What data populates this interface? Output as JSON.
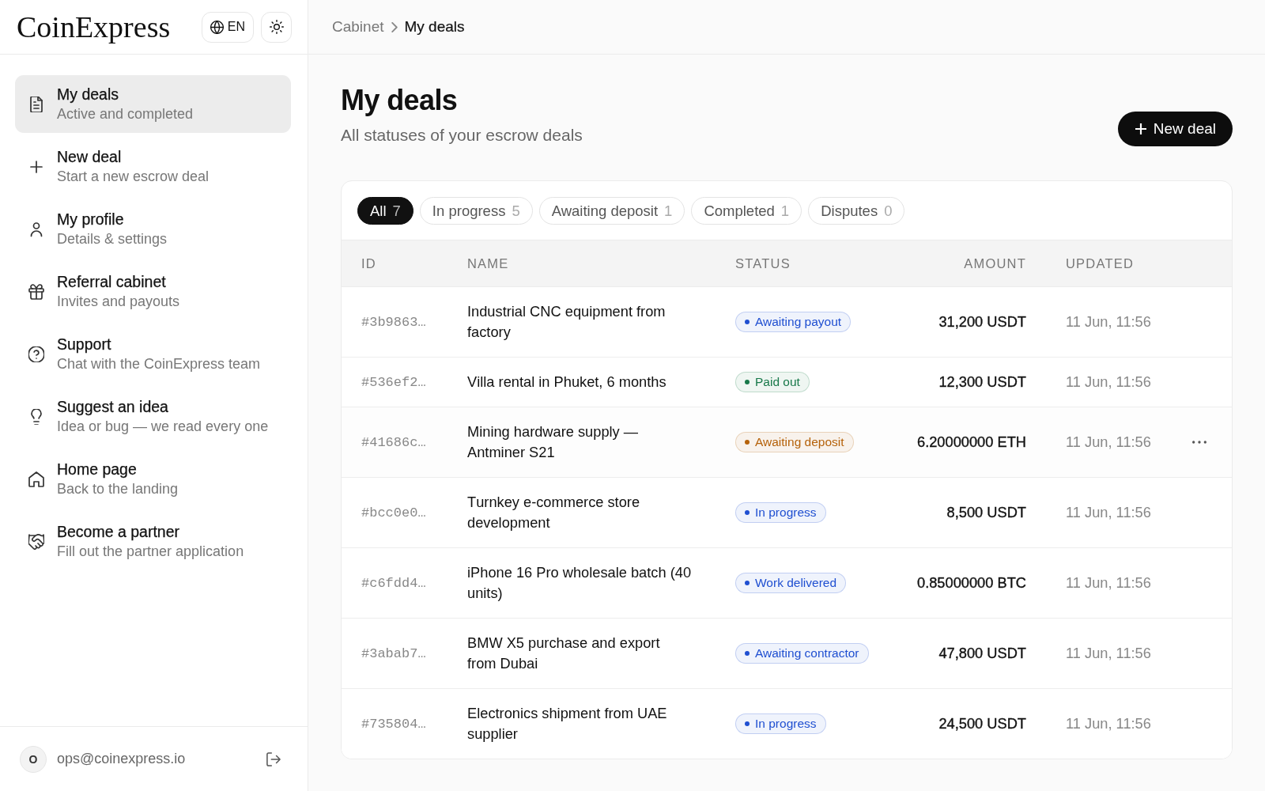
{
  "sidebar": {
    "logo": "CoinExpress",
    "language": "EN",
    "nav": [
      {
        "title": "My deals",
        "subtitle": "Active and completed",
        "selected": true
      },
      {
        "title": "New deal",
        "subtitle": "Start a new escrow deal",
        "selected": false
      },
      {
        "title": "My profile",
        "subtitle": "Details & settings",
        "selected": false
      },
      {
        "title": "Referral cabinet",
        "subtitle": "Invites and payouts",
        "selected": false
      },
      {
        "title": "Support",
        "subtitle": "Chat with the CoinExpress team",
        "selected": false
      },
      {
        "title": "Suggest an idea",
        "subtitle": "Idea or bug — we read every one",
        "selected": false
      },
      {
        "title": "Home page",
        "subtitle": "Back to the landing",
        "selected": false
      },
      {
        "title": "Become a partner",
        "subtitle": "Fill out the partner application",
        "selected": false
      }
    ],
    "user": {
      "initial": "O",
      "email": "ops@coinexpress.io"
    }
  },
  "breadcrumb": [
    {
      "label": "Cabinet",
      "current": false
    },
    {
      "label": "My deals",
      "current": true
    }
  ],
  "page": {
    "title": "My deals",
    "subtitle": "All statuses of your escrow deals",
    "new_deal_button": "New deal"
  },
  "filters": [
    {
      "label": "All",
      "count": "7",
      "selected": true
    },
    {
      "label": "In progress",
      "count": "5",
      "selected": false
    },
    {
      "label": "Awaiting deposit",
      "count": "1",
      "selected": false
    },
    {
      "label": "Completed",
      "count": "1",
      "selected": false
    },
    {
      "label": "Disputes",
      "count": "0",
      "selected": false
    }
  ],
  "table": {
    "columns": [
      "ID",
      "NAME",
      "STATUS",
      "AMOUNT",
      "UPDATED"
    ],
    "rows": [
      {
        "id": "#3b9863…",
        "name": "Industrial CNC equipment from factory",
        "status": {
          "label": "Awaiting payout",
          "color": "#1f4fd1"
        },
        "amount": "31,200 USDT",
        "updated": "11 Jun, 11:56",
        "hovered": false
      },
      {
        "id": "#536ef2…",
        "name": "Villa rental in Phuket, 6 months",
        "status": {
          "label": "Paid out",
          "color": "#18794a"
        },
        "amount": "12,300 USDT",
        "updated": "11 Jun, 11:56",
        "hovered": false
      },
      {
        "id": "#41686c…",
        "name": "Mining hardware supply — Antminer S21",
        "status": {
          "label": "Awaiting deposit",
          "color": "#b5620a"
        },
        "amount": "6.20000000 ETH",
        "updated": "11 Jun, 11:56",
        "hovered": true
      },
      {
        "id": "#bcc0e0…",
        "name": "Turnkey e-commerce store development",
        "status": {
          "label": "In progress",
          "color": "#1f4fd1"
        },
        "amount": "8,500 USDT",
        "updated": "11 Jun, 11:56",
        "hovered": false
      },
      {
        "id": "#c6fdd4…",
        "name": "iPhone 16 Pro wholesale batch (40 units)",
        "status": {
          "label": "Work delivered",
          "color": "#1f4fd1"
        },
        "amount": "0.85000000 BTC",
        "updated": "11 Jun, 11:56",
        "hovered": false
      },
      {
        "id": "#3abab7…",
        "name": "BMW X5 purchase and export from Dubai",
        "status": {
          "label": "Awaiting contractor",
          "color": "#1f4fd1"
        },
        "amount": "47,800 USDT",
        "updated": "11 Jun, 11:56",
        "hovered": false
      },
      {
        "id": "#735804…",
        "name": "Electronics shipment from UAE supplier",
        "status": {
          "label": "In progress",
          "color": "#1f4fd1"
        },
        "amount": "24,500 USDT",
        "updated": "11 Jun, 11:56",
        "hovered": false
      }
    ]
  }
}
